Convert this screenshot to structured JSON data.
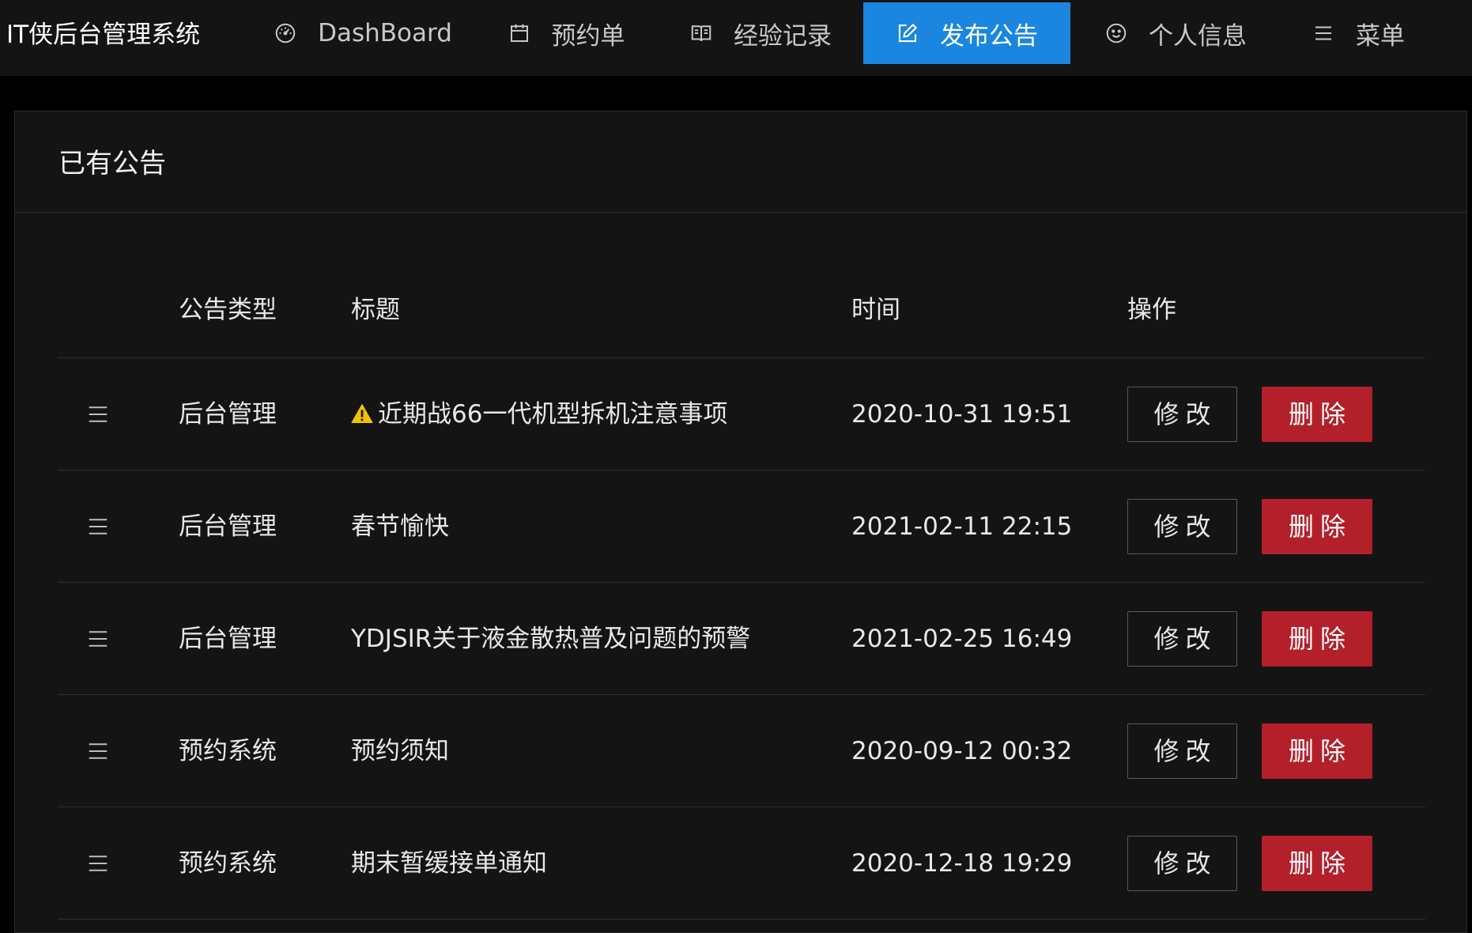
{
  "app": {
    "title": "IT侠后台管理系统"
  },
  "nav": {
    "items": [
      {
        "label": "DashBoard",
        "icon": "dashboard-gauge-icon"
      },
      {
        "label": "预约单",
        "icon": "calendar-icon"
      },
      {
        "label": "经验记录",
        "icon": "book-icon"
      },
      {
        "label": "发布公告",
        "icon": "edit-icon",
        "active": true
      },
      {
        "label": "个人信息",
        "icon": "smile-icon"
      },
      {
        "label": "菜单",
        "icon": "menu-icon"
      }
    ],
    "active_color": "#1a86e0"
  },
  "card": {
    "title": "已有公告"
  },
  "table": {
    "headers": {
      "type": "公告类型",
      "title": "标题",
      "time": "时间",
      "ops": "操作"
    },
    "edit_label": "修改",
    "delete_label": "删除",
    "delete_color": "#b3202a",
    "rows": [
      {
        "type": "后台管理",
        "title": "近期战66一代机型拆机注意事项",
        "time": "2020-10-31 19:51",
        "warning": true
      },
      {
        "type": "后台管理",
        "title": "春节愉快",
        "time": "2021-02-11 22:15"
      },
      {
        "type": "后台管理",
        "title": "YDJSIR关于液金散热普及问题的预警",
        "time": "2021-02-25 16:49"
      },
      {
        "type": "预约系统",
        "title": "预约须知",
        "time": "2020-09-12 00:32"
      },
      {
        "type": "预约系统",
        "title": "期末暂缓接单通知",
        "time": "2020-12-18 19:29"
      }
    ]
  }
}
